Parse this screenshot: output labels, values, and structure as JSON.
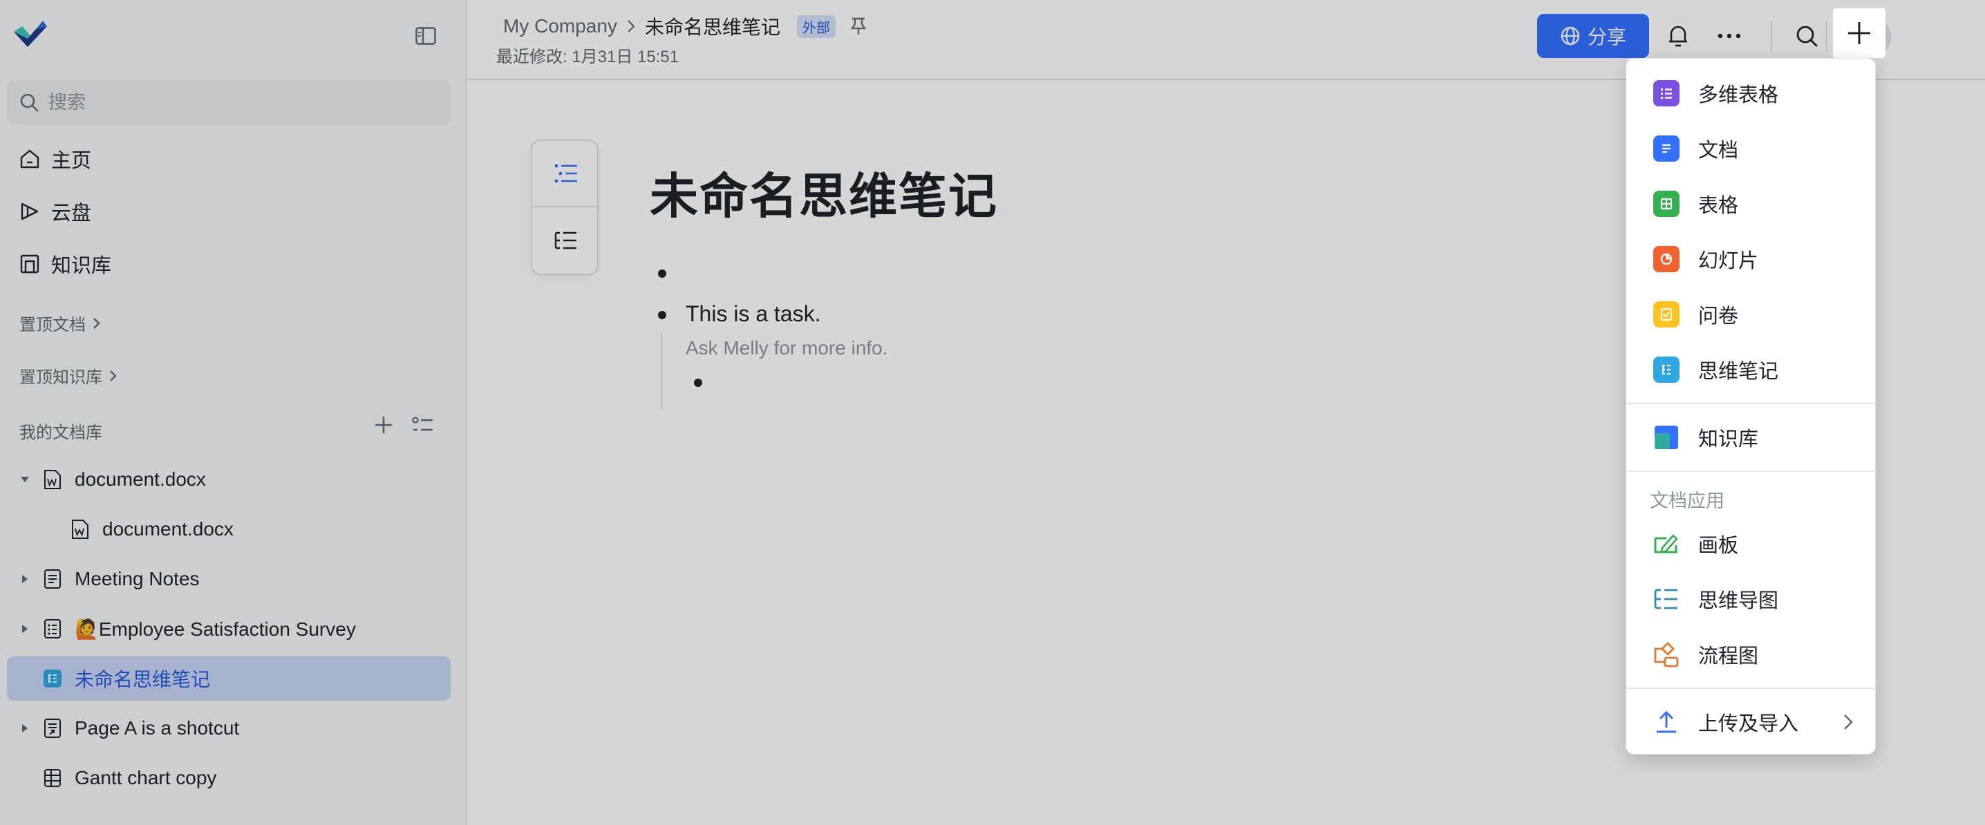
{
  "sidebar": {
    "search_placeholder": "搜索",
    "nav": [
      {
        "label": "主页",
        "icon": "home-icon"
      },
      {
        "label": "云盘",
        "icon": "cloud-drive-icon"
      },
      {
        "label": "知识库",
        "icon": "wiki-icon"
      }
    ],
    "pinned_docs": "置顶文档",
    "pinned_wiki": "置顶知识库",
    "my_library": "我的文档库",
    "tree": [
      {
        "label": "document.docx",
        "icon": "word-file-icon",
        "expanded": true
      },
      {
        "label": "document.docx",
        "icon": "word-file-icon",
        "child": true
      },
      {
        "label": "Meeting Notes",
        "icon": "doc-icon"
      },
      {
        "label": "🙋Employee Satisfaction Survey",
        "icon": "survey-icon"
      },
      {
        "label": "未命名思维笔记",
        "icon": "mindnote-icon",
        "active": true
      },
      {
        "label": "Page A is a shotcut",
        "icon": "shortcut-icon"
      },
      {
        "label": "Gantt chart copy",
        "icon": "gantt-icon"
      }
    ]
  },
  "header": {
    "breadcrumb_root": "My Company",
    "breadcrumb_current": "未命名思维笔记",
    "badge": "外部",
    "last_modified": "最近修改: 1月31日 15:51",
    "share_label": "分享"
  },
  "doc": {
    "title": "未命名思维笔记",
    "task": "This is a task.",
    "note": "Ask Melly for more info."
  },
  "menu": {
    "create_items": [
      {
        "label": "多维表格",
        "icon": "bitable-icon",
        "color": "#7b4fe0"
      },
      {
        "label": "文档",
        "icon": "doc-icon",
        "color": "#3370ff"
      },
      {
        "label": "表格",
        "icon": "sheet-icon",
        "color": "#34b04f"
      },
      {
        "label": "幻灯片",
        "icon": "slides-icon",
        "color": "#f0632d"
      },
      {
        "label": "问卷",
        "icon": "form-icon",
        "color": "#ffc21f"
      },
      {
        "label": "思维笔记",
        "icon": "mindnote-icon",
        "color": "#2ea7e0"
      }
    ],
    "wiki": "知识库",
    "apps_header": "文档应用",
    "apps": [
      {
        "label": "画板",
        "icon": "whiteboard-icon",
        "color": "#34b04f"
      },
      {
        "label": "思维导图",
        "icon": "mindmap-icon",
        "color": "#2e8bc0"
      },
      {
        "label": "流程图",
        "icon": "flowchart-icon",
        "color": "#e0782d"
      }
    ],
    "upload": "上传及导入"
  }
}
